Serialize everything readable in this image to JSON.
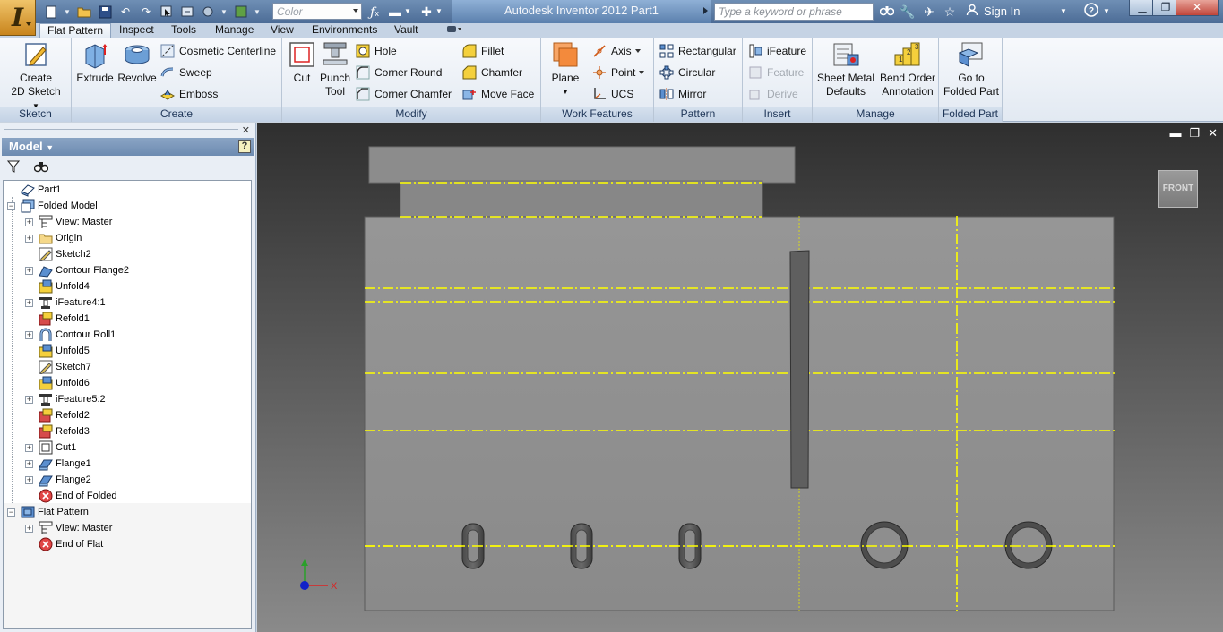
{
  "app": {
    "title": "Autodesk Inventor 2012   Part1",
    "color_placeholder": "Color",
    "search_placeholder": "Type a keyword or phrase",
    "sign_in": "Sign In"
  },
  "ribbon_tabs": [
    "Flat Pattern",
    "Inspect",
    "Tools",
    "Manage",
    "View",
    "Environments",
    "Vault"
  ],
  "ribbon": {
    "sketch": {
      "title": "Sketch",
      "create_2d_sketch": [
        "Create",
        "2D Sketch"
      ]
    },
    "create": {
      "title": "Create",
      "extrude": "Extrude",
      "revolve": "Revolve",
      "cosmetic_centerline": "Cosmetic Centerline",
      "sweep": "Sweep",
      "emboss": "Emboss"
    },
    "modify": {
      "title": "Modify",
      "cut": "Cut",
      "punch_tool": [
        "Punch",
        "Tool"
      ],
      "hole": "Hole",
      "corner_round": "Corner Round",
      "corner_chamfer": "Corner Chamfer",
      "fillet": "Fillet",
      "chamfer": "Chamfer",
      "move_face": "Move Face"
    },
    "work_features": {
      "title": "Work Features",
      "plane": "Plane",
      "axis": "Axis",
      "point": "Point",
      "ucs": "UCS"
    },
    "pattern": {
      "title": "Pattern",
      "rectangular": "Rectangular",
      "circular": "Circular",
      "mirror": "Mirror"
    },
    "insert": {
      "title": "Insert",
      "ifeature": "iFeature",
      "feature": "Feature",
      "derive": "Derive"
    },
    "manage": {
      "title": "Manage",
      "sheet_metal_defaults": [
        "Sheet Metal",
        "Defaults"
      ],
      "bend_order_annotation": [
        "Bend Order",
        "Annotation"
      ]
    },
    "folded_part": {
      "title": "Folded Part",
      "go_to_folded_part": [
        "Go to",
        "Folded Part"
      ]
    }
  },
  "browser": {
    "title": "Model",
    "help": "?",
    "tree": [
      {
        "label": "Part1",
        "level": 0,
        "expander": "",
        "icon": "part-icon"
      },
      {
        "label": "Folded Model",
        "level": 0,
        "expander": "−",
        "icon": "folded-model-icon"
      },
      {
        "label": "View: Master",
        "level": 1,
        "expander": "+",
        "icon": "view-icon"
      },
      {
        "label": "Origin",
        "level": 1,
        "expander": "+",
        "icon": "folder-icon"
      },
      {
        "label": "Sketch2",
        "level": 1,
        "expander": "",
        "icon": "sketch-icon"
      },
      {
        "label": "Contour Flange2",
        "level": 1,
        "expander": "+",
        "icon": "contour-flange-icon"
      },
      {
        "label": "Unfold4",
        "level": 1,
        "expander": "",
        "icon": "unfold-icon"
      },
      {
        "label": "iFeature4:1",
        "level": 1,
        "expander": "+",
        "icon": "ifeature-icon"
      },
      {
        "label": "Refold1",
        "level": 1,
        "expander": "",
        "icon": "refold-icon"
      },
      {
        "label": "Contour Roll1",
        "level": 1,
        "expander": "+",
        "icon": "contour-roll-icon"
      },
      {
        "label": "Unfold5",
        "level": 1,
        "expander": "",
        "icon": "unfold-icon"
      },
      {
        "label": "Sketch7",
        "level": 1,
        "expander": "",
        "icon": "sketch-icon"
      },
      {
        "label": "Unfold6",
        "level": 1,
        "expander": "",
        "icon": "unfold-icon"
      },
      {
        "label": "iFeature5:2",
        "level": 1,
        "expander": "+",
        "icon": "ifeature-icon"
      },
      {
        "label": "Refold2",
        "level": 1,
        "expander": "",
        "icon": "refold-icon"
      },
      {
        "label": "Refold3",
        "level": 1,
        "expander": "",
        "icon": "refold-icon"
      },
      {
        "label": "Cut1",
        "level": 1,
        "expander": "+",
        "icon": "cut-icon"
      },
      {
        "label": "Flange1",
        "level": 1,
        "expander": "+",
        "icon": "flange-icon"
      },
      {
        "label": "Flange2",
        "level": 1,
        "expander": "+",
        "icon": "flange-icon"
      },
      {
        "label": "End of Folded",
        "level": 1,
        "expander": "",
        "icon": "end-of-part-icon"
      },
      {
        "label": "Flat Pattern",
        "level": 0,
        "expander": "−",
        "icon": "flat-pattern-icon"
      },
      {
        "label": "View: Master",
        "level": 1,
        "expander": "+",
        "icon": "view-icon"
      },
      {
        "label": "End of Flat",
        "level": 1,
        "expander": "",
        "icon": "end-of-part-icon"
      }
    ]
  },
  "viewport": {
    "viewcube_face": "FRONT",
    "triad_x": "X"
  }
}
